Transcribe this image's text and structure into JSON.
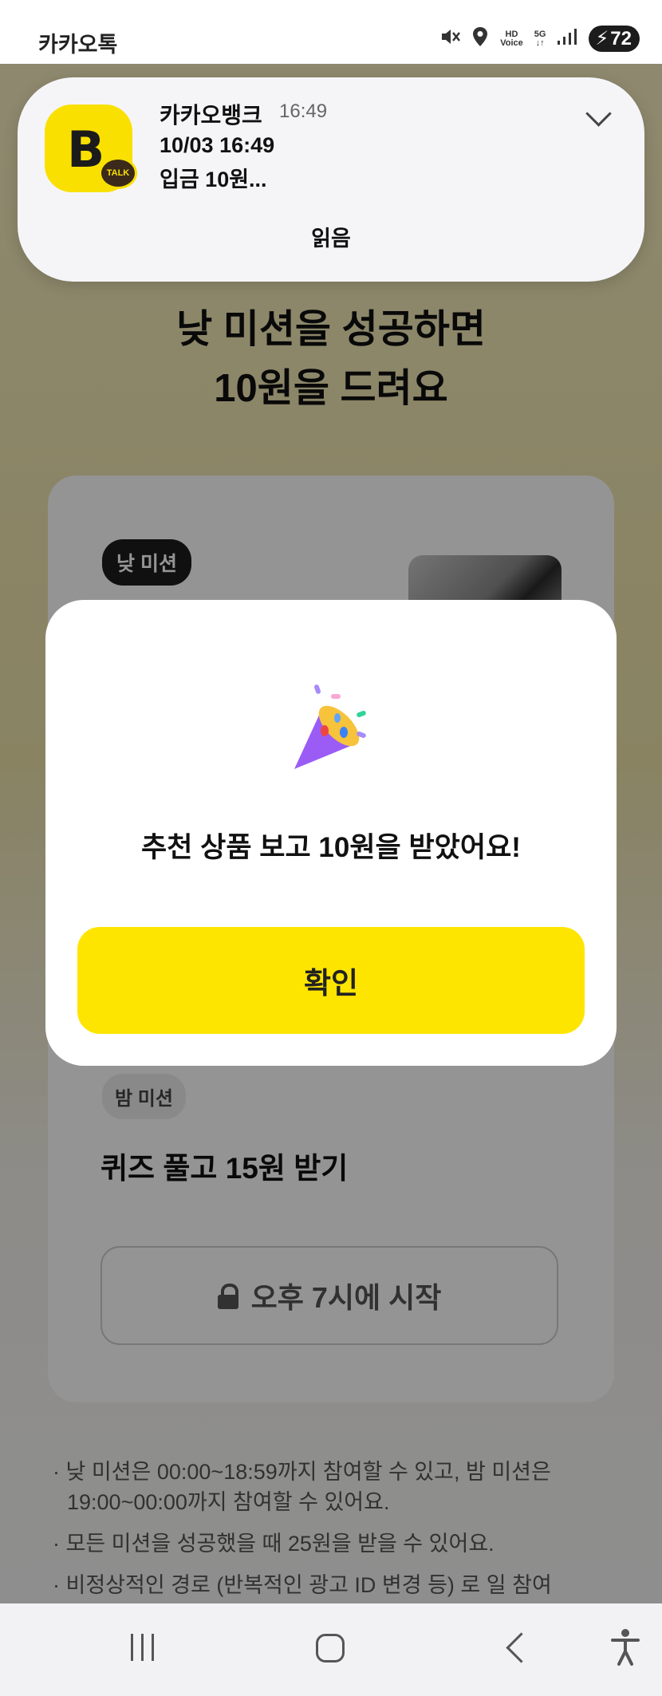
{
  "status_bar": {
    "app_name": "카카오톡",
    "hd_label": "HD",
    "voice_label": "Voice",
    "network_label": "5G",
    "battery_level": "72",
    "icons": [
      "mute-icon",
      "location-icon",
      "hd-voice-icon",
      "5g-icon",
      "signal-icon",
      "battery-charging-icon"
    ]
  },
  "notification": {
    "sender": "카카오뱅크",
    "time": "16:49",
    "line1": "10/03 16:49",
    "line2": "입금 10원...",
    "action_label": "읽음",
    "app_icon_letter": "B",
    "app_icon_badge": "TALK"
  },
  "page": {
    "headline_line1": "낮 미션을 성공하면",
    "headline_line2": "10원을 드려요",
    "day_mission_badge": "낮 미션",
    "night_mission_badge": "밤 미션",
    "night_mission_title": "퀴즈 풀고 15원 받기",
    "night_mission_button": "오후 7시에 시작",
    "notes": [
      "· 낮 미션은 00:00~18:59까지 참여할 수 있고, 밤 미션은 19:00~00:00까지 참여할 수 있어요.",
      "· 모든 미션을 성공했을 때 25원을 받을 수 있어요.",
      "· 비정상적인 경로 (반복적인 광고 ID 변경 등) 로 일 참여"
    ]
  },
  "modal": {
    "icon": "party-popper-icon",
    "message": "추천 상품 보고 10원을 받았어요!",
    "confirm_label": "확인"
  },
  "nav_bar": {
    "icons": [
      "recents-icon",
      "home-icon",
      "back-icon",
      "accessibility-icon"
    ]
  },
  "colors": {
    "kakao_yellow": "#fee500",
    "overlay": "rgba(0,0,0,0.42)",
    "dark_badge": "#1c1c1c"
  }
}
